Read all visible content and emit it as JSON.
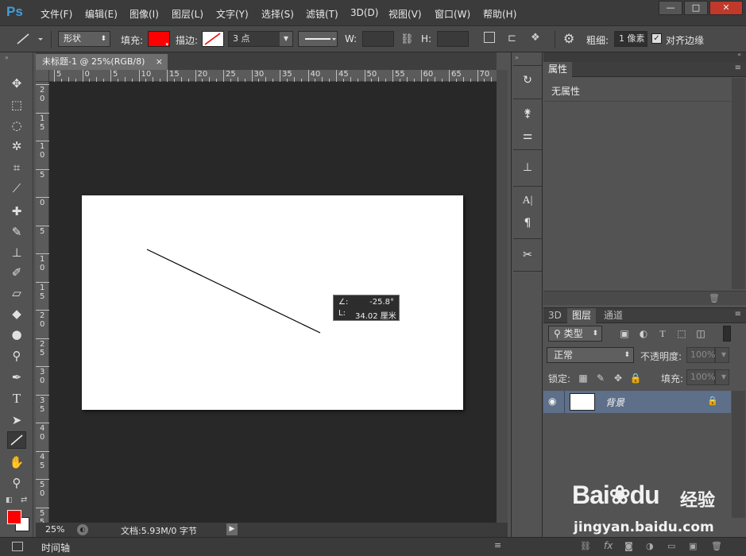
{
  "app": {
    "logo": "Ps",
    "menus": [
      "文件(F)",
      "编辑(E)",
      "图像(I)",
      "图层(L)",
      "文字(Y)",
      "选择(S)",
      "滤镜(T)",
      "3D(D)",
      "视图(V)",
      "窗口(W)",
      "帮助(H)"
    ],
    "window_buttons": {
      "minimize": "—",
      "maximize": "□",
      "close": "✕"
    }
  },
  "options_bar": {
    "mode_select": "形状",
    "fill_label": "填充:",
    "stroke_label": "描边:",
    "stroke_size": "3 点",
    "w_label": "W:",
    "h_label": "H:",
    "weight_label": "粗细:",
    "weight_value": "1 像素",
    "align_edges_label": "对齐边缘",
    "align_edges_checked": true,
    "fill_color": "#ff0000"
  },
  "document": {
    "tab_title": "未标题-1 @ 25%(RGB/8)",
    "tab_close": "×",
    "ruler_top": [
      "5",
      "0",
      "5",
      "10",
      "15",
      "20",
      "25",
      "30",
      "35",
      "40",
      "45",
      "50",
      "55",
      "60",
      "65",
      "70"
    ],
    "ruler_left": [
      [
        "2",
        "0"
      ],
      [
        "1",
        "5"
      ],
      [
        "1",
        "0"
      ],
      [
        "5"
      ],
      [
        "0"
      ],
      [
        "5"
      ],
      [
        "1",
        "0"
      ],
      [
        "1",
        "5"
      ],
      [
        "2",
        "0"
      ],
      [
        "2",
        "5"
      ],
      [
        "3",
        "0"
      ],
      [
        "3",
        "5"
      ],
      [
        "4",
        "0"
      ],
      [
        "4",
        "5"
      ],
      [
        "5",
        "0"
      ],
      [
        "5",
        "5"
      ]
    ],
    "tooltip_angle_label": "∠:",
    "tooltip_angle": "-25.8°",
    "tooltip_length_label": "L:",
    "tooltip_length": "34.02 厘米",
    "zoom": "25%",
    "doc_info": "文档:5.93M/0 字节"
  },
  "timeline": {
    "label": "时间轴"
  },
  "properties_panel": {
    "tab": "属性",
    "content": "无属性"
  },
  "layers_panel": {
    "tabs": [
      "3D",
      "图层",
      "通道"
    ],
    "active_tab": "图层",
    "filter_kind": "类型",
    "blend_mode": "正常",
    "opacity_label": "不透明度:",
    "opacity_value": "100%",
    "lock_label": "锁定:",
    "fill_label": "填充:",
    "fill_value": "100%",
    "layers": [
      {
        "name": "背景",
        "visible": true,
        "locked": true
      }
    ]
  },
  "watermark": {
    "brand": "Bai",
    "brand_after": "du",
    "chinese": "经验",
    "url": "jingyan.baidu.com"
  },
  "colors": {
    "accent_blue": "#3f9de0",
    "foreground_color": "#ff0000",
    "background_color": "#ffffff",
    "selected_layer": "#5d6f89"
  }
}
